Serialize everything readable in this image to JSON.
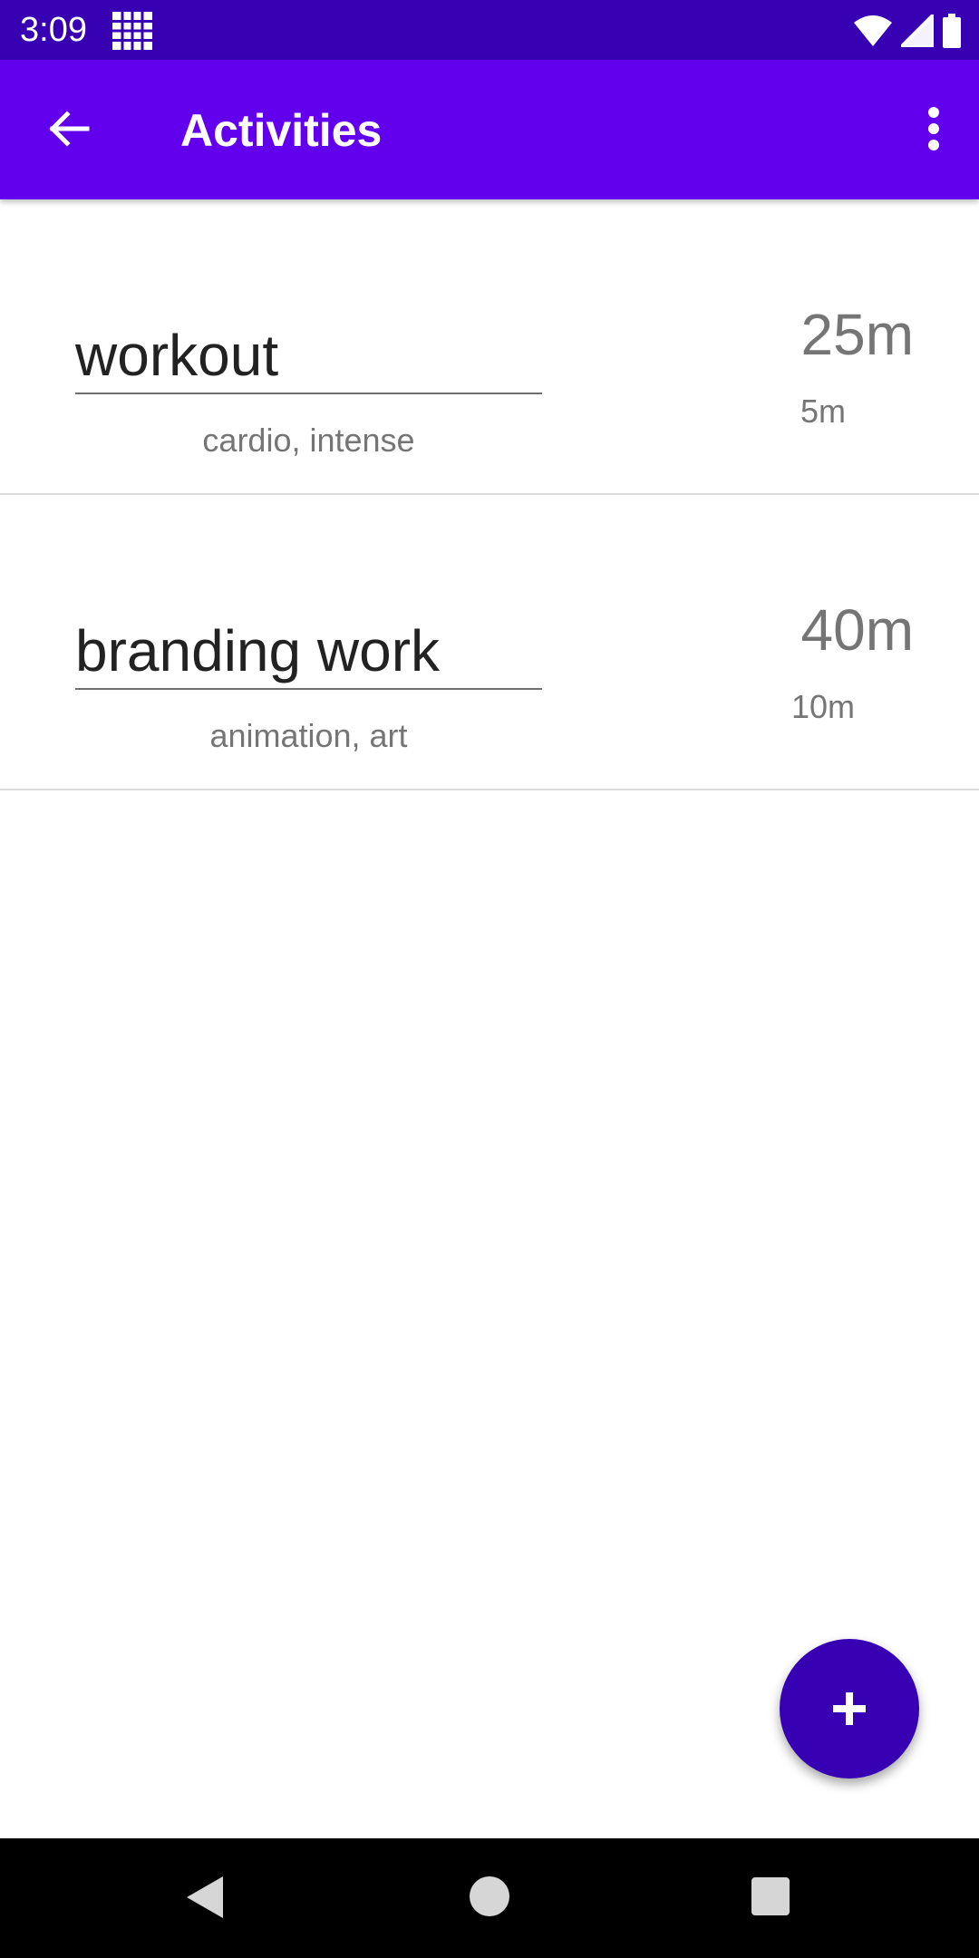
{
  "status_bar": {
    "time": "3:09",
    "background": "#3700b3",
    "icons": [
      "app-grid-icon",
      "wifi-icon",
      "signal-icon",
      "battery-icon"
    ]
  },
  "app_bar": {
    "title": "Activities",
    "background": "#6200ee",
    "back_icon": "arrow-back-icon",
    "menu_icon": "more-vert-icon"
  },
  "activities": [
    {
      "name": "workout",
      "tags": "cardio, intense",
      "total": "25m",
      "sub": "5m"
    },
    {
      "name": "branding work",
      "tags": "animation, art",
      "total": "40m",
      "sub": "10m"
    }
  ],
  "fab": {
    "icon": "plus-icon",
    "background": "#3700b3"
  },
  "nav_bar": {
    "icons": [
      "nav-back-icon",
      "nav-home-icon",
      "nav-recents-icon"
    ]
  }
}
